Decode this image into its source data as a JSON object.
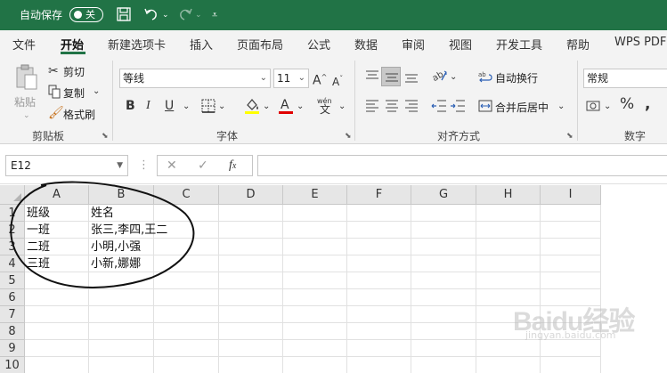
{
  "titlebar": {
    "autosave_label": "自动保存",
    "autosave_state": "关"
  },
  "tabs": [
    {
      "label": "文件"
    },
    {
      "label": "开始"
    },
    {
      "label": "新建选项卡"
    },
    {
      "label": "插入"
    },
    {
      "label": "页面布局"
    },
    {
      "label": "公式"
    },
    {
      "label": "数据"
    },
    {
      "label": "审阅"
    },
    {
      "label": "视图"
    },
    {
      "label": "开发工具"
    },
    {
      "label": "帮助"
    },
    {
      "label": "WPS PDF"
    }
  ],
  "ribbon": {
    "clipboard": {
      "paste": "粘贴",
      "cut": "剪切",
      "copy": "复制",
      "format_painter": "格式刷",
      "group": "剪贴板"
    },
    "font": {
      "font_name": "等线",
      "font_size": "11",
      "bold": "B",
      "italic": "I",
      "underline": "U",
      "phonetic": "wén",
      "group": "字体"
    },
    "alignment": {
      "wrap": "自动换行",
      "merge": "合并后居中",
      "group": "对齐方式"
    },
    "number": {
      "format": "常规",
      "percent": "%",
      "group": "数字"
    }
  },
  "formula": {
    "cell_ref": "E12",
    "value": ""
  },
  "sheet": {
    "columns": [
      "A",
      "B",
      "C",
      "D",
      "E",
      "F",
      "G",
      "H",
      "I"
    ],
    "rows": [
      "1",
      "2",
      "3",
      "4",
      "5",
      "6",
      "7",
      "8",
      "9",
      "10"
    ],
    "cells": [
      [
        "班级",
        "姓名"
      ],
      [
        "一班",
        "张三,李四,王二"
      ],
      [
        "二班",
        "小明,小强"
      ],
      [
        "三班",
        "小新,娜娜"
      ]
    ]
  },
  "watermark": {
    "brand": "Baidu经验",
    "url": "jingyan.baidu.com"
  },
  "colors": {
    "excel_green": "#217346",
    "ribbon_bg": "#f3f3f3",
    "header_bg": "#e6e6e6"
  }
}
